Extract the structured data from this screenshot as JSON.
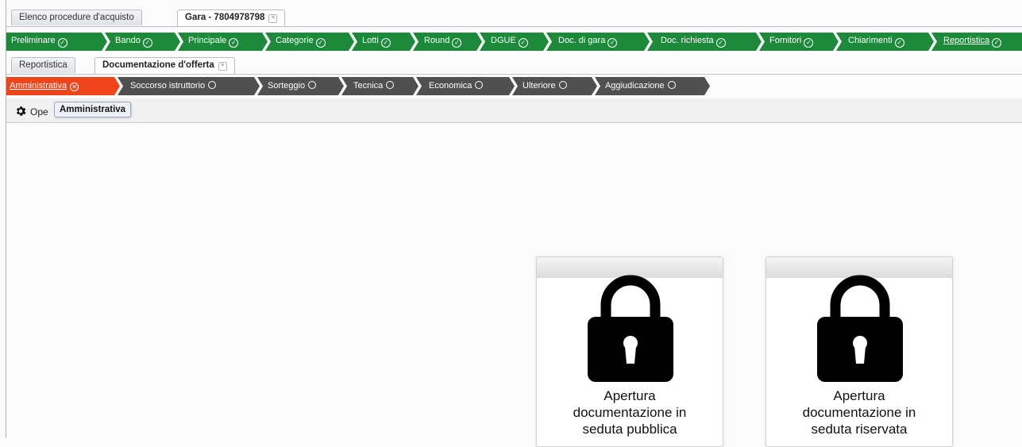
{
  "tabs": [
    {
      "label": "Elenco procedure d'acquisto",
      "active": false,
      "closable": false
    },
    {
      "label": "Gara - 7804978798",
      "active": true,
      "closable": true
    }
  ],
  "workflow_steps": [
    {
      "label": "Preliminare",
      "status": "done"
    },
    {
      "label": "Bando",
      "status": "done"
    },
    {
      "label": "Principale",
      "status": "done"
    },
    {
      "label": "Categorie",
      "status": "done"
    },
    {
      "label": "Lotti",
      "status": "done"
    },
    {
      "label": "Round",
      "status": "done"
    },
    {
      "label": "DGUE",
      "status": "done"
    },
    {
      "label": "Doc. di gara",
      "status": "done"
    },
    {
      "label": "Doc. richiesta",
      "status": "done"
    },
    {
      "label": "Fornitori",
      "status": "done"
    },
    {
      "label": "Chiarimenti",
      "status": "done"
    },
    {
      "label": "Reportistica",
      "status": "done",
      "current": true
    }
  ],
  "subtabs": [
    {
      "label": "Reportistica",
      "active": false,
      "closable": false
    },
    {
      "label": "Documentazione d'offerta",
      "active": true,
      "closable": true
    }
  ],
  "phases": [
    {
      "label": "Amministrativa",
      "state": "active"
    },
    {
      "label": "Soccorso istruttorio",
      "state": "pending"
    },
    {
      "label": "Sorteggio",
      "state": "pending"
    },
    {
      "label": "Tecnica",
      "state": "pending"
    },
    {
      "label": "Economica",
      "state": "pending"
    },
    {
      "label": "Ulteriore",
      "state": "pending"
    },
    {
      "label": "Aggiudicazione",
      "state": "pending"
    }
  ],
  "toolbar": {
    "operations_label": "Ope",
    "gear_icon": "gear-icon"
  },
  "tooltip": {
    "text": "Amministrativa"
  },
  "cards": [
    {
      "icon": "lock-icon",
      "caption_lines": [
        "Apertura",
        "documentazione in",
        "seduta pubblica"
      ]
    },
    {
      "icon": "lock-icon",
      "caption_lines": [
        "Apertura",
        "documentazione in",
        "seduta riservata"
      ]
    }
  ],
  "colors": {
    "workflow_green": "#1c8a3a",
    "phase_active": "#f0451b",
    "phase_pending": "#505050"
  }
}
